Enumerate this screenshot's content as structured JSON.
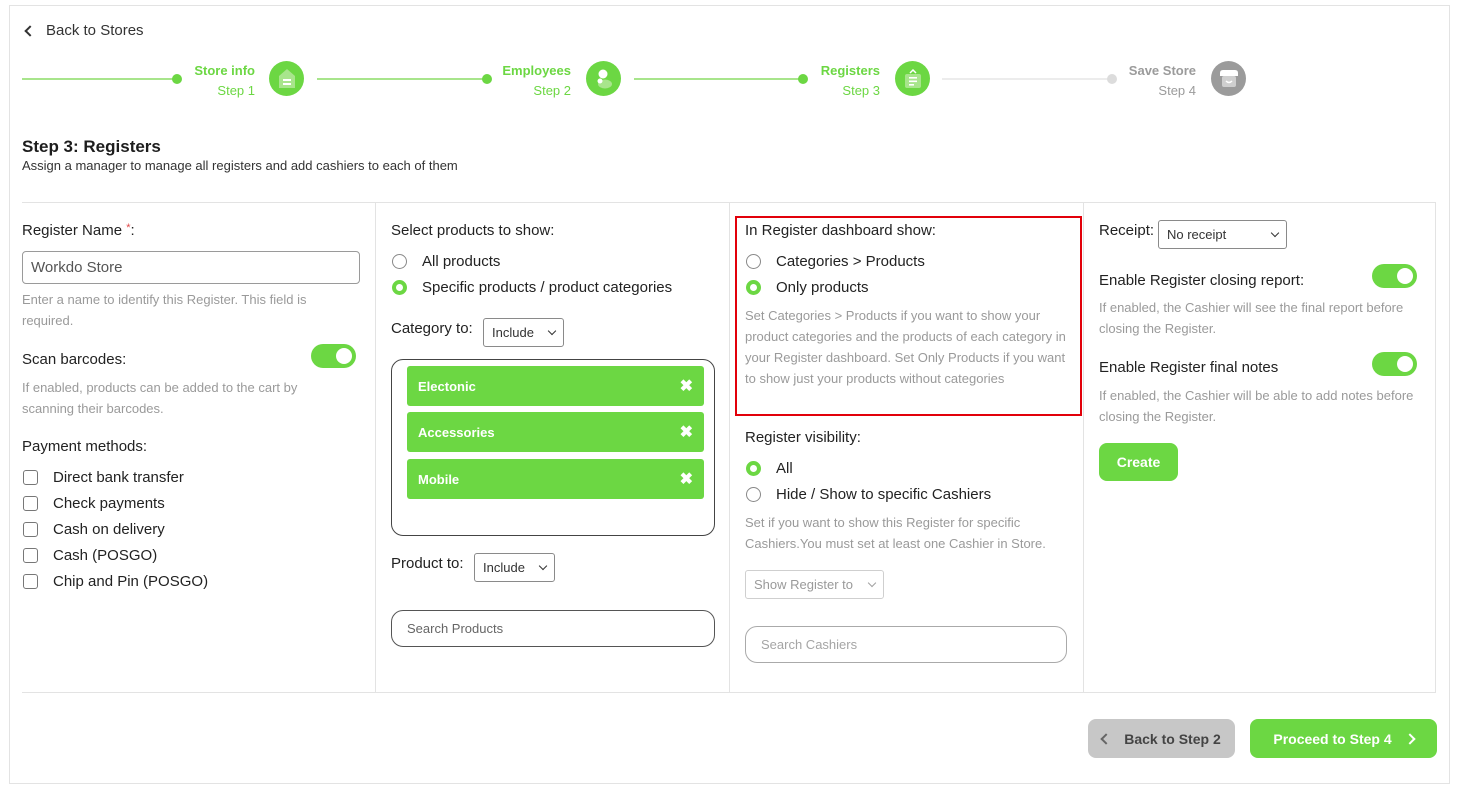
{
  "nav": {
    "back_label": "Back to Stores"
  },
  "stepper": {
    "steps": [
      {
        "title": "Store info",
        "subtitle": "Step 1",
        "icon": "store-info-icon",
        "state": "active"
      },
      {
        "title": "Employees",
        "subtitle": "Step 2",
        "icon": "employees-icon",
        "state": "active"
      },
      {
        "title": "Registers",
        "subtitle": "Step 3",
        "icon": "registers-icon",
        "state": "active"
      },
      {
        "title": "Save Store",
        "subtitle": "Step 4",
        "icon": "save-store-icon",
        "state": "inactive"
      }
    ]
  },
  "page": {
    "title": "Step 3: Registers",
    "subtitle": "Assign a manager to manage all registers and add cashiers to each of them"
  },
  "column1": {
    "register_name_label": "Register Name",
    "required_mark": "*",
    "label_suffix": ":",
    "register_name_value": "Workdo Store",
    "register_name_help": "Enter a name to identify this Register. This field is required.",
    "scan_barcodes_label": "Scan barcodes:",
    "scan_barcodes_enabled": true,
    "scan_barcodes_help": "If enabled, products can be added to the cart by scanning their barcodes.",
    "payment_methods_label": "Payment methods:",
    "payment_methods": [
      {
        "label": "Direct bank transfer",
        "checked": false
      },
      {
        "label": "Check payments",
        "checked": false
      },
      {
        "label": "Cash on delivery",
        "checked": false
      },
      {
        "label": "Cash (POSGO)",
        "checked": false
      },
      {
        "label": "Chip and Pin (POSGO)",
        "checked": false
      }
    ]
  },
  "column2": {
    "select_products_label": "Select products to show:",
    "product_options": [
      {
        "label": "All products",
        "selected": false
      },
      {
        "label": "Specific products / product categories",
        "selected": true
      }
    ],
    "category_to_label": "Category to:",
    "category_to_value": "Include",
    "categories": [
      {
        "label": "Electonic",
        "remove_icon": "✖"
      },
      {
        "label": "Accessories",
        "remove_icon": "✖"
      },
      {
        "label": "Mobile",
        "remove_icon": "✖"
      }
    ],
    "product_to_label": "Product to:",
    "product_to_value": "Include",
    "search_products_placeholder": "Search Products"
  },
  "column3": {
    "dashboard_show_label": "In Register dashboard show:",
    "dashboard_options": [
      {
        "label": "Categories > Products",
        "selected": false
      },
      {
        "label": "Only products",
        "selected": true
      }
    ],
    "dashboard_help": "Set Categories > Products if you want to show your product categories and the products of each category in your Register dashboard. Set Only Products if you want to show just your products without categories",
    "visibility_label": "Register visibility:",
    "visibility_options": [
      {
        "label": "All",
        "selected": true
      },
      {
        "label": "Hide / Show to specific Cashiers",
        "selected": false
      }
    ],
    "visibility_help": "Set if you want to show this Register for specific Cashiers.You must set at least one Cashier in Store.",
    "show_register_to_value": "Show Register to",
    "search_cashiers_placeholder": "Search Cashiers"
  },
  "column4": {
    "receipt_label": "Receipt:",
    "receipt_value": "No receipt",
    "closing_report_label": "Enable Register closing report:",
    "closing_report_enabled": true,
    "closing_report_help": "If enabled, the Cashier will see the final report before closing the Register.",
    "final_notes_label": "Enable Register final notes",
    "final_notes_enabled": true,
    "final_notes_help": "If enabled, the Cashier will be able to add notes before closing the Register.",
    "create_label": "Create"
  },
  "footer": {
    "back_label": "Back to Step 2",
    "proceed_label": "Proceed to Step 4"
  },
  "colors": {
    "accent": "#6cd743",
    "highlight": "#e2000a",
    "inactive": "#9b9b9b"
  }
}
